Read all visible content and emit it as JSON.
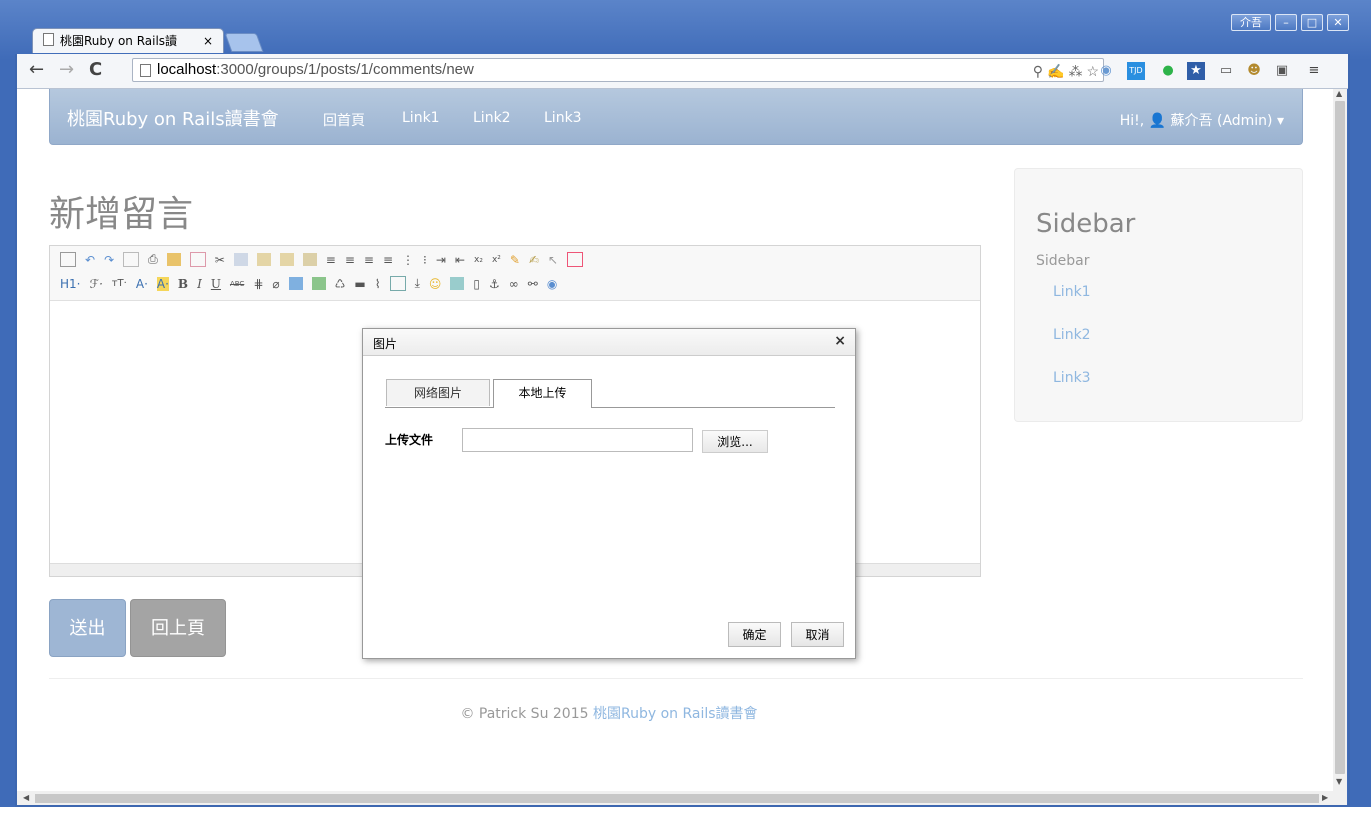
{
  "window": {
    "profile_button": "介吾",
    "minimize": "–",
    "maximize": "□",
    "close": "✕"
  },
  "tab": {
    "title": "桃園Ruby on Rails讀",
    "close": "×"
  },
  "address_bar": {
    "host": "localhost",
    "path": ":3000/groups/1/posts/1/comments/new"
  },
  "navbar": {
    "brand": "桃園Ruby on Rails讀書會",
    "links": [
      "回首頁",
      "Link1",
      "Link2",
      "Link3"
    ],
    "user": "Hi!, 👤 蘇介吾 (Admin) ▾"
  },
  "page": {
    "title": "新增留言",
    "submit_button": "送出",
    "back_button": "回上頁"
  },
  "editor": {
    "toolbar_row2_labels": [
      "H1·",
      "ℱ·",
      "тT·",
      "A·",
      "A·",
      "B",
      "I",
      "U",
      "ABC"
    ]
  },
  "sidebar": {
    "heading": "Sidebar",
    "subheading": "Sidebar",
    "links": [
      "Link1",
      "Link2",
      "Link3"
    ]
  },
  "footer": {
    "copyright": "© Patrick Su 2015 ",
    "link": "桃園Ruby on Rails讀書會"
  },
  "dialog": {
    "title": "图片",
    "close": "×",
    "tabs": [
      "网络图片",
      "本地上传"
    ],
    "active_tab": "本地上传",
    "field_label": "上传文件",
    "browse_button": "浏览...",
    "ok_button": "确定",
    "cancel_button": "取消"
  }
}
